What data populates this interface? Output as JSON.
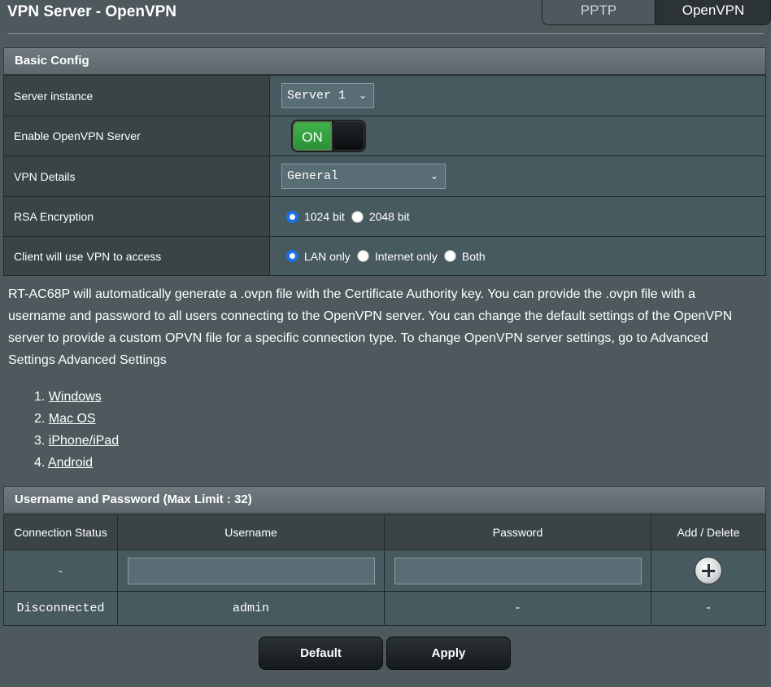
{
  "page": {
    "title": "VPN Server - OpenVPN",
    "tabs": [
      {
        "label": "PPTP",
        "active": false
      },
      {
        "label": "OpenVPN",
        "active": true
      }
    ]
  },
  "basic_config": {
    "header": "Basic Config",
    "rows": {
      "server_instance": {
        "label": "Server instance",
        "value": "Server 1"
      },
      "enable_server": {
        "label": "Enable OpenVPN Server",
        "toggle_text": "ON"
      },
      "vpn_details": {
        "label": "VPN Details",
        "value": "General"
      },
      "rsa_encryption": {
        "label": "RSA Encryption",
        "options": [
          "1024 bit",
          "2048 bit"
        ],
        "selected": "1024 bit"
      },
      "client_access": {
        "label": "Client will use VPN to access",
        "options": [
          "LAN only",
          "Internet only",
          "Both"
        ],
        "selected": "LAN only"
      }
    }
  },
  "description": "RT-AC68P will automatically generate a .ovpn file with the Certificate Authority key. You can provide the .ovpn file with a username and password to all users connecting to the OpenVPN server. You can change the default settings of the OpenVPN server to provide a custom OPVN file for a specific connection type. To change OpenVPN server settings, go to Advanced Settings Advanced Settings",
  "os_links": [
    "Windows",
    "Mac OS",
    "iPhone/iPad",
    "Android"
  ],
  "users": {
    "header": "Username and Password (Max Limit : 32)",
    "columns": [
      "Connection Status",
      "Username",
      "Password",
      "Add / Delete"
    ],
    "new_row": {
      "status": "-"
    },
    "rows": [
      {
        "status": "Disconnected",
        "username": "admin",
        "password": "-",
        "action": "-"
      }
    ]
  },
  "buttons": {
    "default": "Default",
    "apply": "Apply"
  }
}
